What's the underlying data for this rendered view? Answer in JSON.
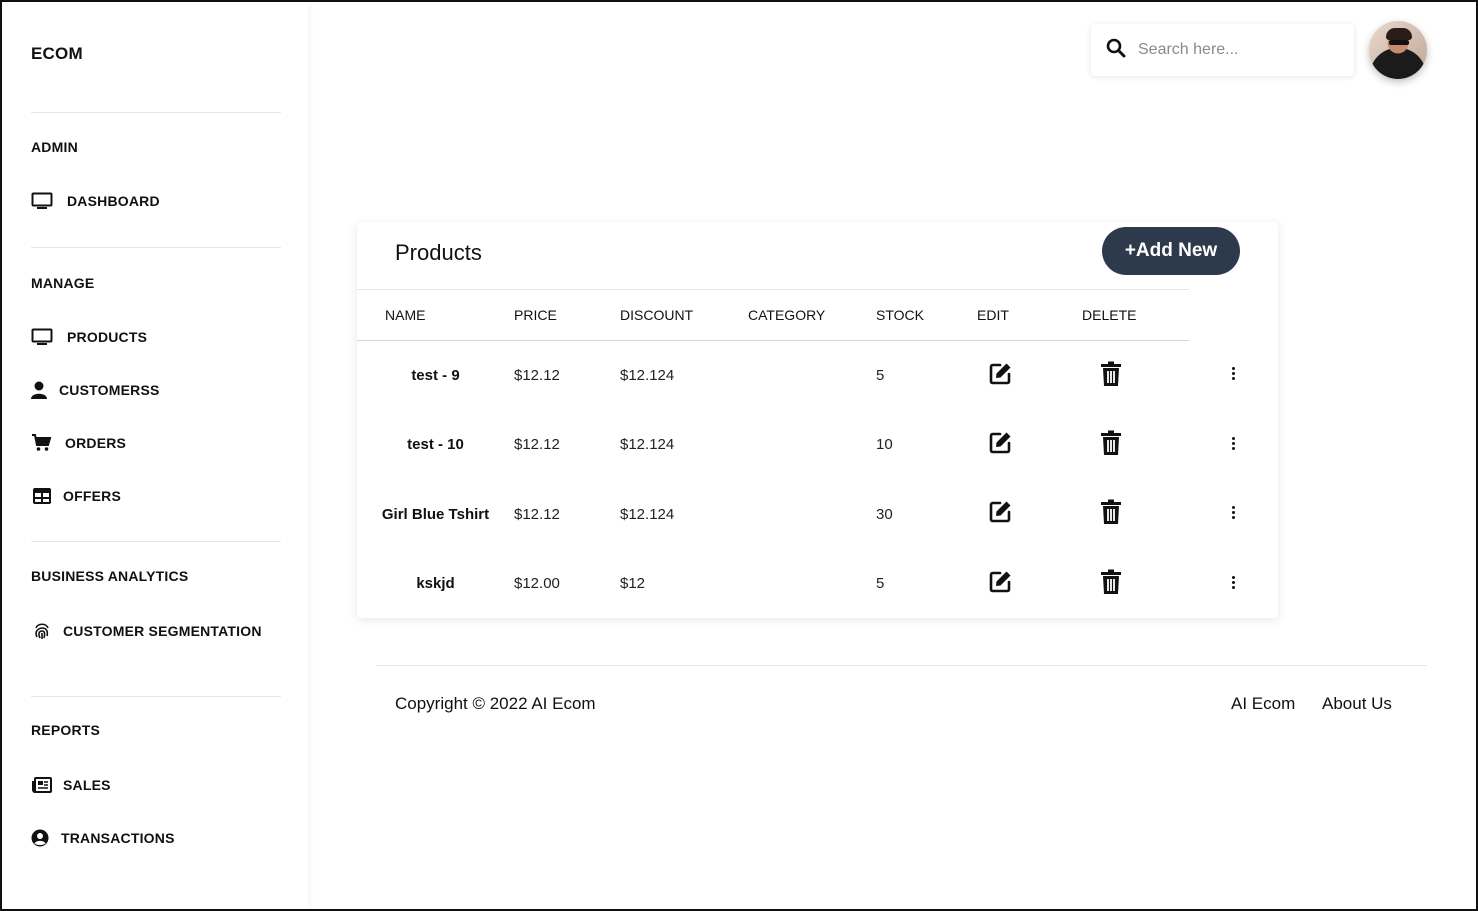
{
  "sidebar": {
    "brand": "ECOM",
    "sections": {
      "admin": "ADMIN",
      "manage": "MANAGE",
      "business": "BUSINESS ANALYTICS",
      "reports": "REPORTS"
    },
    "items": {
      "dashboard": "DASHBOARD",
      "products": "PRODUCTS",
      "customers": "CUSTOMERSS",
      "orders": "ORDERS",
      "offers": "OFFERS",
      "segmentation": "CUSTOMER SEGMENTATION",
      "sales": "SALES",
      "transactions": "TRANSACTIONS"
    }
  },
  "header": {
    "search_placeholder": "Search here..."
  },
  "products": {
    "title": "Products",
    "add_label": "+Add New",
    "columns": {
      "name": "NAME",
      "price": "PRICE",
      "discount": "DISCOUNT",
      "category": "CATEGORY",
      "stock": "STOCK",
      "edit": "EDIT",
      "delete": "DELETE"
    },
    "rows": [
      {
        "name": "test - 9",
        "price": "$12.12",
        "discount": "$12.124",
        "category": "",
        "stock": "5"
      },
      {
        "name": "test - 10",
        "price": "$12.12",
        "discount": "$12.124",
        "category": "",
        "stock": "10"
      },
      {
        "name": "Girl Blue Tshirt",
        "price": "$12.12",
        "discount": "$12.124",
        "category": "",
        "stock": "30"
      },
      {
        "name": "kskjd",
        "price": "$12.00",
        "discount": "$12",
        "category": "",
        "stock": "5"
      }
    ]
  },
  "footer": {
    "copyright": "Copyright © 2022 AI Ecom",
    "links": [
      "AI Ecom",
      "About Us"
    ]
  },
  "colors": {
    "button_bg": "#2d3a4b",
    "text": "#111111"
  }
}
